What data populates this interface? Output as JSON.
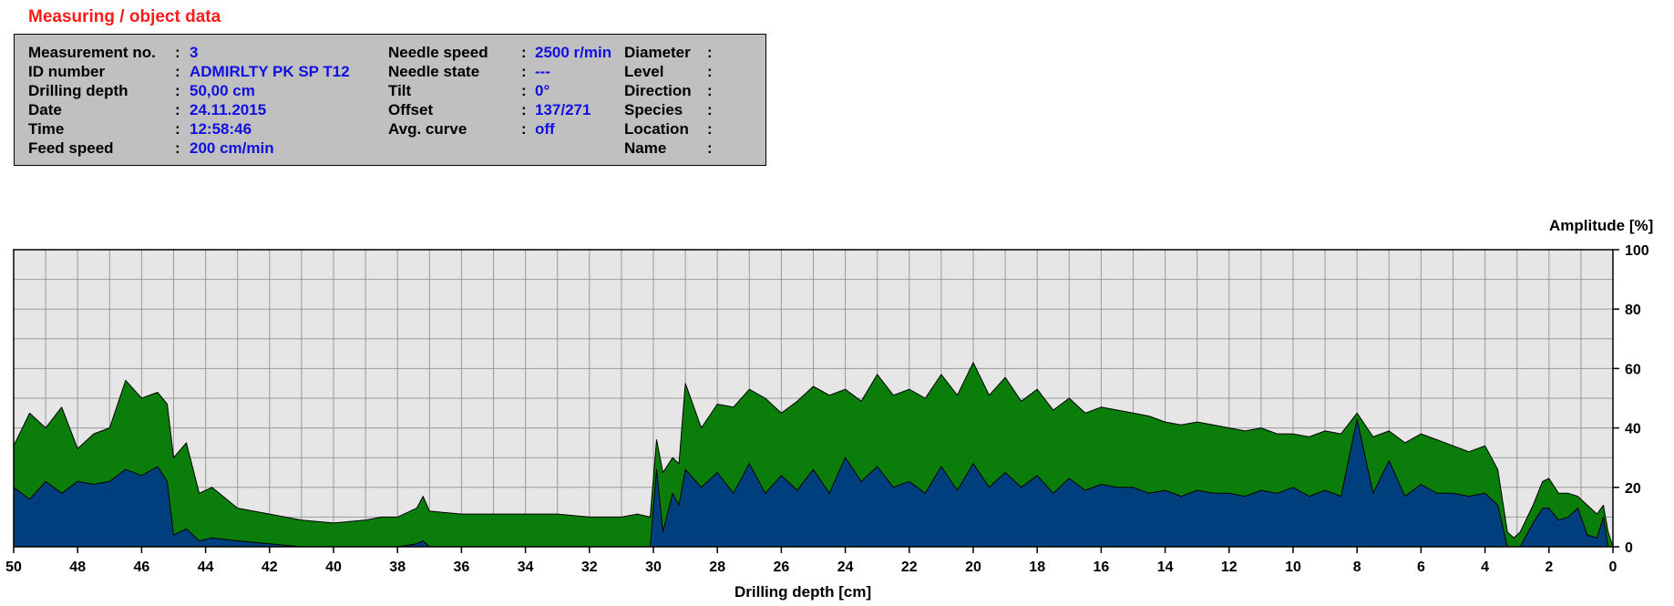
{
  "section_title": "Measuring / object data",
  "info": {
    "col1": [
      {
        "label": "Measurement no.",
        "value": "3"
      },
      {
        "label": "ID number",
        "value": "ADMIRLTY PK SP T12"
      },
      {
        "label": "Drilling depth",
        "value": "50,00 cm"
      },
      {
        "label": "Date",
        "value": "24.11.2015"
      },
      {
        "label": "Time",
        "value": "12:58:46"
      },
      {
        "label": "Feed speed",
        "value": "200 cm/min"
      }
    ],
    "col2": [
      {
        "label": "Needle speed",
        "value": "2500 r/min"
      },
      {
        "label": "Needle state",
        "value": "---"
      },
      {
        "label": "Tilt",
        "value": "0°"
      },
      {
        "label": "Offset",
        "value": "137/271"
      },
      {
        "label": "Avg. curve",
        "value": "off"
      }
    ],
    "col3": [
      {
        "label": "Diameter",
        "value": ""
      },
      {
        "label": "Level",
        "value": ""
      },
      {
        "label": "Direction",
        "value": ""
      },
      {
        "label": "Species",
        "value": ""
      },
      {
        "label": "Location",
        "value": ""
      },
      {
        "label": "Name",
        "value": ""
      }
    ]
  },
  "colors": {
    "title": "#ff1a1a",
    "values": "#1010e0",
    "series_back": "#0a7d0a",
    "series_front": "#003f7d",
    "plot_bg": "#e6e6e6",
    "grid": "#9a9a9a"
  },
  "chart_data": {
    "type": "area",
    "xlabel": "Drilling depth [cm]",
    "ylabel": "Amplitude [%]",
    "xlim": [
      50,
      0
    ],
    "ylim": [
      0,
      100
    ],
    "xticks": [
      50,
      48,
      46,
      44,
      42,
      40,
      38,
      36,
      34,
      32,
      30,
      28,
      26,
      24,
      22,
      20,
      18,
      16,
      14,
      12,
      10,
      8,
      6,
      4,
      2,
      0
    ],
    "yticks": [
      0,
      20,
      40,
      60,
      80,
      100
    ],
    "grid": true,
    "series": [
      {
        "x": [
          50,
          49.5,
          49,
          48.5,
          48,
          47.5,
          47,
          46.5,
          46,
          45.5,
          45.2,
          45,
          44.6,
          44.2,
          43.8,
          43,
          42,
          41,
          40,
          39,
          38.5,
          38,
          37.4,
          37.2,
          37,
          36,
          35,
          34,
          33,
          32,
          31,
          30.5,
          30.1,
          29.9,
          29.7,
          29.4,
          29.2,
          29,
          28.5,
          28,
          27.5,
          27,
          26.5,
          26,
          25.5,
          25,
          24.5,
          24,
          23.5,
          23,
          22.5,
          22,
          21.5,
          21,
          20.5,
          20,
          19.5,
          19,
          18.5,
          18,
          17.5,
          17,
          16.5,
          16,
          15.5,
          15,
          14.5,
          14,
          13.5,
          13,
          12.5,
          12,
          11.5,
          11,
          10.5,
          10,
          9.5,
          9,
          8.5,
          8,
          7.5,
          7,
          6.5,
          6,
          5.5,
          5,
          4.5,
          4,
          3.6,
          3.3,
          3.1,
          2.9,
          2.5,
          2.2,
          2,
          1.7,
          1.4,
          1.1,
          0.8,
          0.5,
          0.3,
          0.15,
          0
        ],
        "values": [
          34,
          45,
          40,
          47,
          33,
          38,
          40,
          56,
          50,
          52,
          48,
          30,
          35,
          18,
          20,
          13,
          11,
          9,
          8,
          9,
          10,
          10,
          13,
          17,
          12,
          11,
          11,
          11,
          11,
          10,
          10,
          11,
          10,
          36,
          25,
          30,
          28,
          55,
          40,
          48,
          47,
          53,
          50,
          45,
          49,
          54,
          51,
          53,
          49,
          58,
          51,
          53,
          50,
          58,
          51,
          62,
          51,
          57,
          49,
          53,
          46,
          50,
          45,
          47,
          46,
          45,
          44,
          42,
          41,
          42,
          41,
          40,
          39,
          40,
          38,
          38,
          37,
          39,
          38,
          45,
          37,
          39,
          35,
          38,
          36,
          34,
          32,
          34,
          26,
          5,
          3,
          5,
          14,
          22,
          23,
          18,
          18,
          17,
          14,
          11,
          14,
          5,
          0
        ],
        "name": ""
      },
      {
        "x": [
          50,
          49.5,
          49,
          48.5,
          48,
          47.5,
          47,
          46.5,
          46,
          45.5,
          45.2,
          45,
          44.6,
          44.2,
          43.8,
          43,
          42,
          41,
          40,
          39,
          38.5,
          38,
          37.4,
          37.2,
          37,
          36,
          35,
          34,
          33,
          32,
          31,
          30.5,
          30.1,
          29.9,
          29.7,
          29.4,
          29.2,
          29,
          28.5,
          28,
          27.5,
          27,
          26.5,
          26,
          25.5,
          25,
          24.5,
          24,
          23.5,
          23,
          22.5,
          22,
          21.5,
          21,
          20.5,
          20,
          19.5,
          19,
          18.5,
          18,
          17.5,
          17,
          16.5,
          16,
          15.5,
          15,
          14.5,
          14,
          13.5,
          13,
          12.5,
          12,
          11.5,
          11,
          10.5,
          10,
          9.5,
          9,
          8.5,
          8,
          7.5,
          7,
          6.5,
          6,
          5.5,
          5,
          4.5,
          4,
          3.6,
          3.3,
          3.1,
          2.9,
          2.5,
          2.2,
          2,
          1.7,
          1.4,
          1.1,
          0.8,
          0.5,
          0.3,
          0.15,
          0
        ],
        "values": [
          20,
          16,
          22,
          18,
          22,
          21,
          22,
          26,
          24,
          27,
          22,
          4,
          6,
          2,
          3,
          2,
          1,
          0,
          0,
          0,
          0,
          0,
          1,
          2,
          0,
          0,
          0,
          0,
          0,
          0,
          0,
          0,
          0,
          26,
          5,
          18,
          14,
          26,
          20,
          25,
          18,
          28,
          18,
          24,
          19,
          26,
          18,
          30,
          22,
          27,
          20,
          22,
          18,
          27,
          19,
          28,
          20,
          25,
          20,
          24,
          18,
          23,
          19,
          21,
          20,
          20,
          18,
          19,
          17,
          19,
          18,
          18,
          17,
          19,
          18,
          20,
          17,
          19,
          17,
          43,
          18,
          29,
          17,
          21,
          18,
          18,
          17,
          18,
          14,
          0,
          0,
          0,
          8,
          13,
          13,
          9,
          10,
          13,
          4,
          3,
          10,
          0,
          0
        ],
        "name": ""
      }
    ]
  }
}
